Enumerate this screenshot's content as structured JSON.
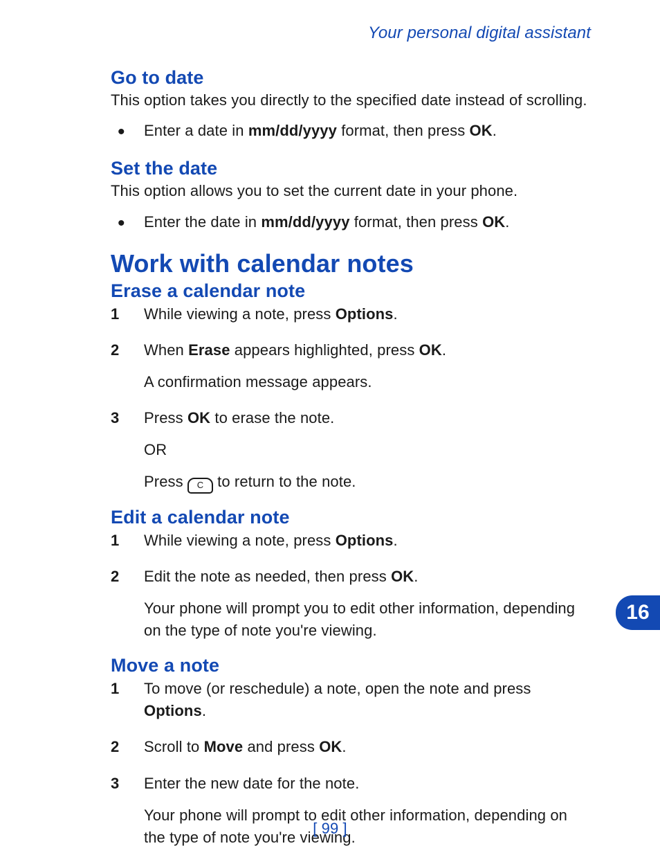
{
  "header": "Your personal digital assistant",
  "chapter_number": "16",
  "page_number": "[ 99 ]",
  "sections": {
    "go_to_date": {
      "title": "Go to date",
      "desc": "This option takes you directly to the specified date instead of scrolling.",
      "bullets": {
        "b1_before": "Enter a date in ",
        "b1_bold": "mm/dd/yyyy",
        "b1_mid": " format, then press ",
        "b1_bold2": "OK",
        "b1_end": "."
      }
    },
    "set_the_date": {
      "title": "Set the date",
      "desc": "This option allows you to set the current date in your phone.",
      "bullets": {
        "b1_before": "Enter the date in ",
        "b1_bold": "mm/dd/yyyy",
        "b1_mid": " format, then press ",
        "b1_bold2": "OK",
        "b1_end": "."
      }
    },
    "work_heading": "Work with calendar notes",
    "erase": {
      "title": "Erase a calendar note",
      "steps": {
        "s1_before": "While viewing a note, press ",
        "s1_bold": "Options",
        "s1_end": ".",
        "s2_before": "When ",
        "s2_bold": "Erase",
        "s2_mid": " appears highlighted, press ",
        "s2_bold2": "OK",
        "s2_end": ".",
        "s2_after": "A confirmation message appears.",
        "s3_before": "Press ",
        "s3_bold": "OK",
        "s3_end": " to erase the note.",
        "s3_after1": "OR",
        "s3_after2_before": "Press ",
        "s3_after2_key": "C",
        "s3_after2_end": " to return to the note."
      }
    },
    "edit": {
      "title": "Edit a calendar note",
      "steps": {
        "s1_before": "While viewing a note, press ",
        "s1_bold": "Options",
        "s1_end": ".",
        "s2_before": "Edit the note as needed, then press ",
        "s2_bold": "OK",
        "s2_end": ".",
        "s2_after": "Your phone will prompt you to edit other information, depending on the type of note you're viewing."
      }
    },
    "move": {
      "title": "Move a note",
      "steps": {
        "s1_before": "To move (or reschedule) a note, open the note and press ",
        "s1_bold": "Options",
        "s1_end": ".",
        "s2_before": "Scroll to ",
        "s2_bold": "Move",
        "s2_mid": " and press ",
        "s2_bold2": "OK",
        "s2_end": ".",
        "s3": "Enter the new date for the note.",
        "s3_after": "Your phone will prompt to edit other information, depending on the type of note you're viewing."
      }
    }
  }
}
